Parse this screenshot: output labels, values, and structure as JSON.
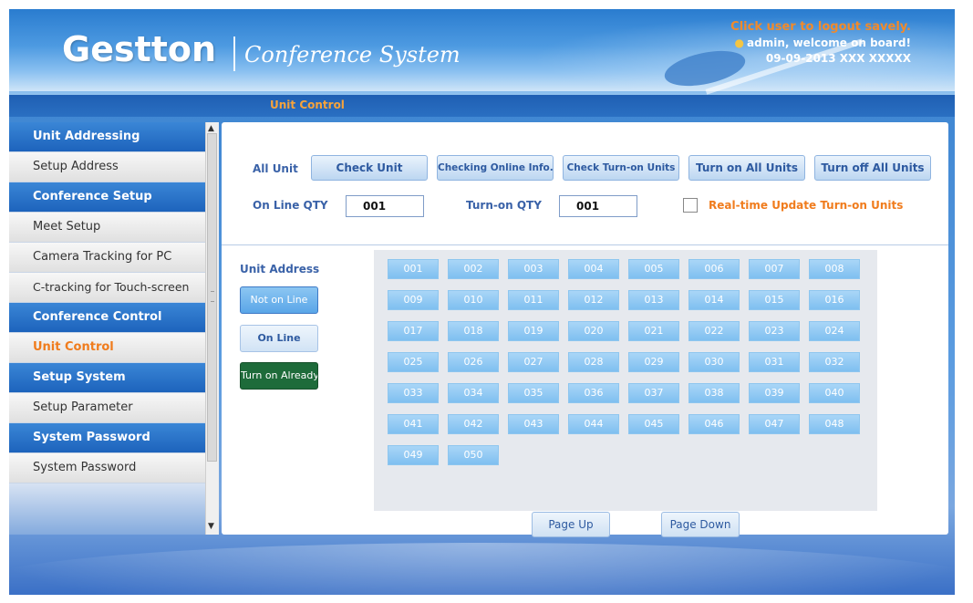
{
  "header": {
    "logo_text": "Gestton",
    "subtitle": "Conference System",
    "logout_link": "Click user to logout savely.",
    "welcome": "admin, welcome on board!",
    "datetime": "09-09-2013 XXX XXXXX"
  },
  "titlebar": {
    "title": "Unit Control"
  },
  "sidebar": {
    "items": [
      {
        "label": "Unit Addressing",
        "type": "group"
      },
      {
        "label": "Setup Address",
        "type": "sub"
      },
      {
        "label": "Conference Setup",
        "type": "group"
      },
      {
        "label": "Meet Setup",
        "type": "sub"
      },
      {
        "label": "Camera Tracking for PC",
        "type": "sub"
      },
      {
        "label": "C-tracking for Touch-screen",
        "type": "sub"
      },
      {
        "label": "Conference Control",
        "type": "group"
      },
      {
        "label": "Unit Control",
        "type": "sub",
        "active": true
      },
      {
        "label": "Setup System",
        "type": "group"
      },
      {
        "label": "Setup Parameter",
        "type": "sub"
      },
      {
        "label": "System Password",
        "type": "group"
      },
      {
        "label": "System Password",
        "type": "sub"
      }
    ]
  },
  "controls": {
    "all_unit_label": "All Unit",
    "buttons": {
      "check_unit": "Check Unit",
      "checking_online": "Checking Online Info.",
      "check_turnon": "Check Turn-on Units",
      "turn_on_all": "Turn on All Units",
      "turn_off_all": "Turn off All Units"
    },
    "online_qty_label": "On Line QTY",
    "online_qty_value": "001",
    "turnon_qty_label": "Turn-on QTY",
    "turnon_qty_value": "001",
    "realtime_label": "Real-time Update Turn-on Units",
    "realtime_checked": false
  },
  "legend": {
    "title": "Unit Address",
    "not_online": "Not on Line",
    "online": "On Line",
    "turn_on_already": "Turn on Already"
  },
  "units": [
    "001",
    "002",
    "003",
    "004",
    "005",
    "006",
    "007",
    "008",
    "009",
    "010",
    "011",
    "012",
    "013",
    "014",
    "015",
    "016",
    "017",
    "018",
    "019",
    "020",
    "021",
    "022",
    "023",
    "024",
    "025",
    "026",
    "027",
    "028",
    "029",
    "030",
    "031",
    "032",
    "033",
    "034",
    "035",
    "036",
    "037",
    "038",
    "039",
    "040",
    "041",
    "042",
    "043",
    "044",
    "045",
    "046",
    "047",
    "048",
    "049",
    "050"
  ],
  "pager": {
    "page_up": "Page Up",
    "page_down": "Page Down"
  },
  "colors": {
    "accent_orange": "#f07c1d",
    "nav_group_blue": "#1d63bc",
    "unit_not_online": "#7fbff0",
    "turn_on_green": "#1e6b3a"
  }
}
